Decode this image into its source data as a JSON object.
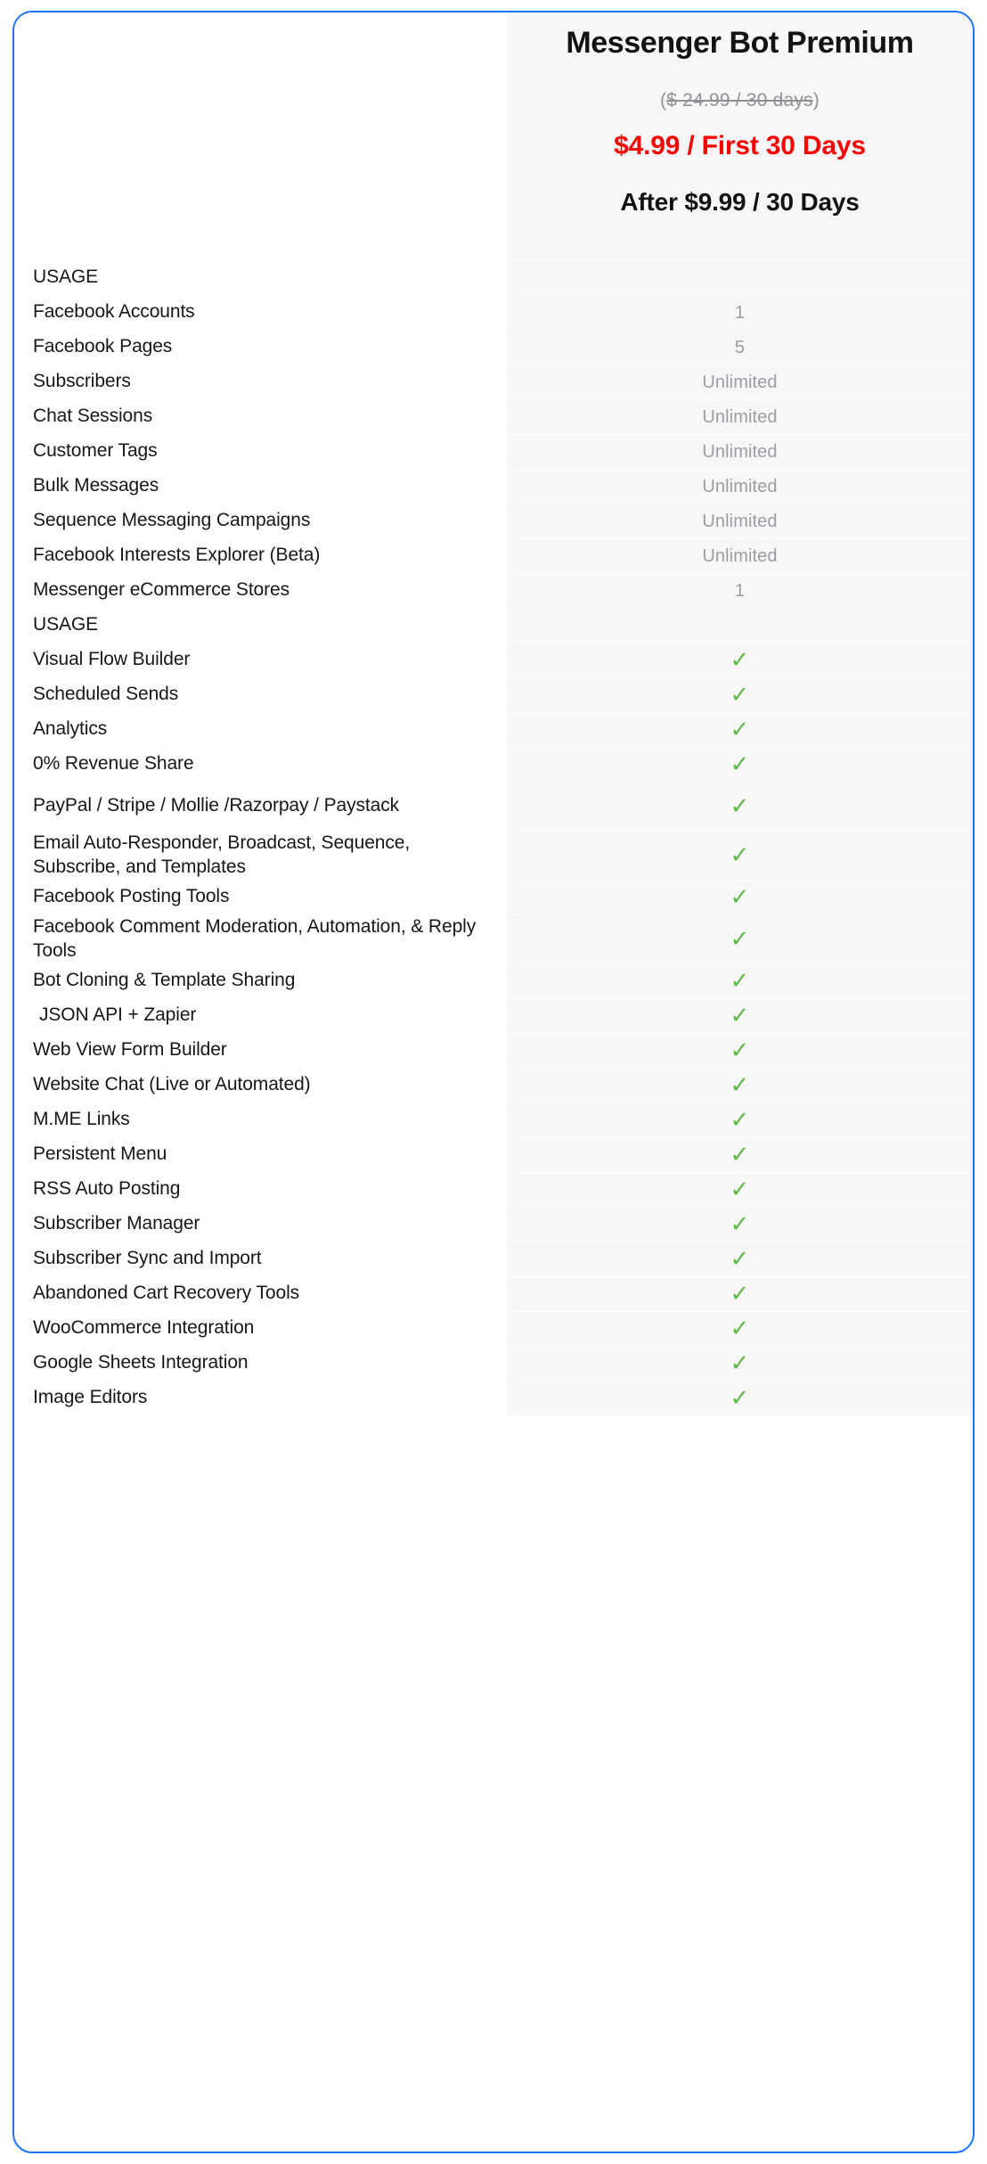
{
  "card": {
    "border_color": "#1a73ff",
    "value_column_bg": "#f7f7f8"
  },
  "header": {
    "plan_title": "Messenger Bot Premium",
    "price_old_open": "(",
    "price_old_struck": "$ 24.99 / 30 days",
    "price_old_close": ")",
    "price_promo": "$4.99 / First 30 Days",
    "price_promo_color": "#ff0000",
    "price_after": "After $9.99 / 30 Days"
  },
  "sections": [
    {
      "title": "USAGE",
      "rows": [
        {
          "label": "Facebook Accounts",
          "value": "1",
          "type": "text"
        },
        {
          "label": "Facebook Pages",
          "value": "5",
          "type": "text"
        },
        {
          "label": "Subscribers",
          "value": "Unlimited",
          "type": "text"
        },
        {
          "label": "Chat Sessions",
          "value": "Unlimited",
          "type": "text"
        },
        {
          "label": "Customer Tags",
          "value": "Unlimited",
          "type": "text"
        },
        {
          "label": "Bulk Messages",
          "value": "Unlimited",
          "type": "text"
        },
        {
          "label": "Sequence Messaging Campaigns",
          "value": "Unlimited",
          "type": "text"
        },
        {
          "label": "Facebook Interests Explorer (Beta)",
          "value": "Unlimited",
          "type": "text"
        },
        {
          "label": "Messenger eCommerce Stores",
          "value": "1",
          "type": "text"
        }
      ]
    },
    {
      "title": "USAGE",
      "rows": [
        {
          "label": "Visual Flow Builder",
          "value": "✓",
          "type": "check"
        },
        {
          "label": "Scheduled Sends",
          "value": "✓",
          "type": "check"
        },
        {
          "label": "Analytics",
          "value": "✓",
          "type": "check"
        },
        {
          "label": "0% Revenue Share",
          "value": "✓",
          "type": "check"
        },
        {
          "label": "PayPal / Stripe / Mollie /Razorpay / Paystack",
          "value": "✓",
          "type": "check"
        },
        {
          "label": "Email Auto-Responder, Broadcast, Sequence, Subscribe, and Templates",
          "value": "✓",
          "type": "check"
        },
        {
          "label": "Facebook Posting Tools",
          "value": "✓",
          "type": "check"
        },
        {
          "label": "Facebook Comment Moderation, Automation, & Reply Tools",
          "value": "✓",
          "type": "check"
        },
        {
          "label": "Bot Cloning & Template Sharing",
          "value": "✓",
          "type": "check"
        },
        {
          "label": "JSON API + Zapier",
          "value": "✓",
          "type": "check"
        },
        {
          "label": "Web View Form Builder",
          "value": "✓",
          "type": "check"
        },
        {
          "label": "Website Chat (Live or Automated)",
          "value": "✓",
          "type": "check"
        },
        {
          "label": "M.ME Links",
          "value": "✓",
          "type": "check"
        },
        {
          "label": "Persistent Menu",
          "value": "✓",
          "type": "check"
        },
        {
          "label": "RSS Auto Posting",
          "value": "✓",
          "type": "check"
        },
        {
          "label": "Subscriber Manager",
          "value": "✓",
          "type": "check"
        },
        {
          "label": "Subscriber Sync and Import",
          "value": "✓",
          "type": "check"
        },
        {
          "label": "Abandoned Cart Recovery Tools",
          "value": "✓",
          "type": "check"
        },
        {
          "label": "WooCommerce Integration",
          "value": "✓",
          "type": "check"
        },
        {
          "label": "Google Sheets Integration",
          "value": "✓",
          "type": "check"
        },
        {
          "label": "Image Editors",
          "value": "✓",
          "type": "check"
        }
      ]
    }
  ]
}
